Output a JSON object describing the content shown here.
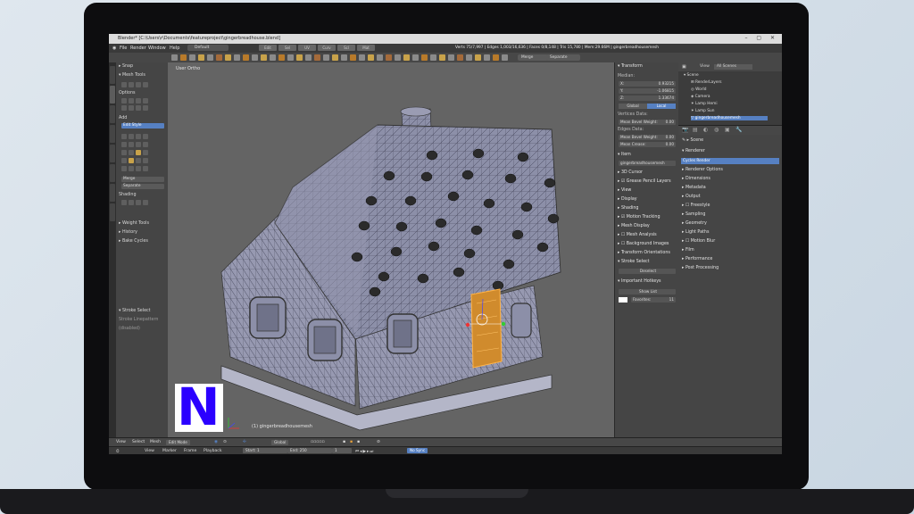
{
  "window": {
    "title": "Blender* [C:\\Users\\r\\Documents\\featureproject\\gingerbreadhouse.blend]",
    "controls": "–  ▢  ✕"
  },
  "menu": [
    "File",
    "Render",
    "Window",
    "Help"
  ],
  "layout": "Default",
  "context_tabs": [
    "Edit",
    "Sel",
    "UV",
    "Curv",
    "Scl",
    "Mat"
  ],
  "stats": "Verts 75/7,997 | Edges 1,003/16,636 | Faces 0/8,148 | Tris 15,780 | Mem:29.66M | gingerbreadhousemesh",
  "toolbar": {
    "merge_dropdown": "Merge",
    "separate_dropdown": "Separate"
  },
  "toolshelf": {
    "sections": {
      "snap": "Snap",
      "mesh_tools": "Mesh Tools",
      "options": "Options",
      "add": "Add",
      "add_value": "Edit Style",
      "merge": "Merge",
      "separate": "Separate",
      "shading": "Shading",
      "weight_tools": "Weight Tools",
      "history": "History",
      "bake_cycles": "Bake Cycles",
      "stroke_select": "Stroke Select",
      "stroke_item1": "Stroke Linepattern",
      "stroke_item2": "(disabled)"
    }
  },
  "viewport": {
    "view_label": "User Ortho",
    "object_label": "(1) gingerbreadhousemesh",
    "logo_letter": "N"
  },
  "properties": {
    "transform": "Transform",
    "median": "Median:",
    "x_label": "X:",
    "x_value": "0.93215",
    "y_label": "Y:",
    "y_value": "-1.06815",
    "z_label": "Z:",
    "z_value": "1.33674",
    "global": "Global",
    "local": "Local",
    "vertices_data": "Vertices Data:",
    "mean_bevel_weight": "Mean Bevel Weight:",
    "mean_bevel_value": "0.00",
    "edges_data": "Edges Data:",
    "mean_bevel_weight_e": "Mean Bevel Weight:",
    "mean_bevel_value_e": "0.00",
    "mean_crease": "Mean Crease:",
    "mean_crease_value": "0.00",
    "item": "Item",
    "item_name": "gingerbreadhousemesh",
    "cursor_3d": "3D Cursor",
    "grease_pencil": "Grease Pencil Layers",
    "view": "View",
    "display": "Display",
    "shading": "Shading",
    "motion_tracking": "Motion Tracking",
    "mesh_display": "Mesh Display",
    "mesh_analysis": "Mesh Analysis",
    "background_images": "Background Images",
    "transform_orientations": "Transform Orientations",
    "stroke_select": "Stroke Select",
    "deselect": "Deselect",
    "important_hotkeys": "Important Hotkeys",
    "show_list": "Show List",
    "favorites_label": "Favorites:",
    "favorites_value": "11"
  },
  "outliner": {
    "view": "View",
    "scenes": "All Scenes",
    "items": [
      "Scene",
      "RenderLayers",
      "World",
      "Camera",
      "Lamp Hemi",
      "Lamp Sun",
      "gingerbreadhousemesh"
    ]
  },
  "render_panel": {
    "scene": "Scene",
    "renderer": "Renderer",
    "engine": "Cycles Render",
    "rows": [
      "Renderer Options",
      "Dimensions",
      "Metadata",
      "Output",
      "Freestyle",
      "Sampling",
      "Geometry",
      "Light Paths",
      "Motion Blur",
      "Film",
      "Performance",
      "Post Processing"
    ]
  },
  "bottom_header": {
    "items": [
      "View",
      "Select",
      "Mesh"
    ],
    "mode": "Edit Mode",
    "orientation": "Global"
  },
  "timeline": {
    "items": [
      "View",
      "Marker",
      "Frame",
      "Playback"
    ],
    "start_label": "Start:",
    "start_value": "1",
    "end_label": "End:",
    "end_value": "250",
    "current": "1",
    "sync": "No Sync"
  },
  "colors": {
    "accent": "#5680c2",
    "logo_letter": "#2b00ff",
    "door": "#d08b2d"
  }
}
